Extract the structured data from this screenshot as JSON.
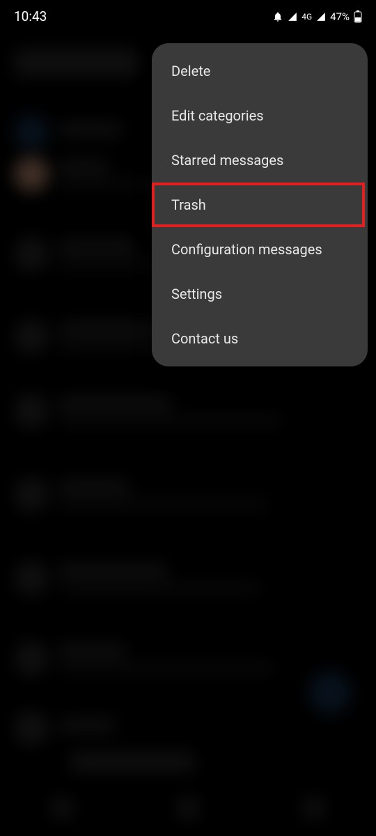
{
  "status_bar": {
    "time": "10:43",
    "network_label": "4G",
    "battery_percent": "47%"
  },
  "menu": {
    "items": [
      "Delete",
      "Edit categories",
      "Starred messages",
      "Trash",
      "Configuration messages",
      "Settings",
      "Contact us"
    ],
    "highlighted_index": 3
  }
}
